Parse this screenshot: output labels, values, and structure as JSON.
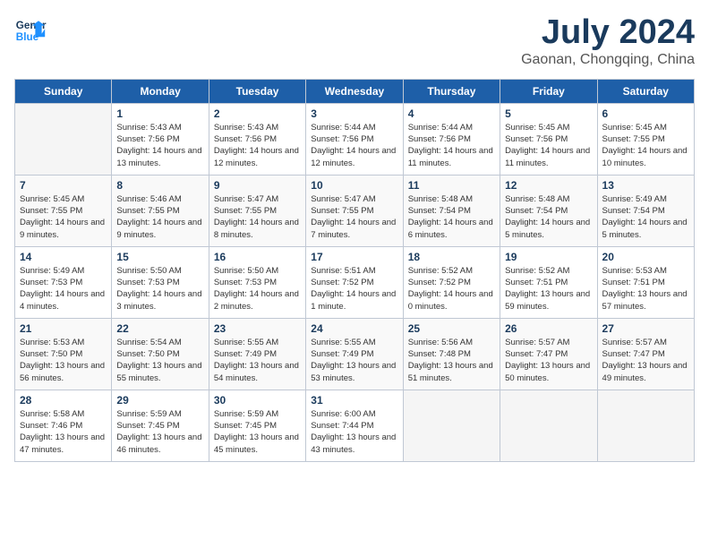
{
  "header": {
    "logo_line1": "General",
    "logo_line2": "Blue",
    "month_title": "July 2024",
    "location": "Gaonan, Chongqing, China"
  },
  "days_of_week": [
    "Sunday",
    "Monday",
    "Tuesday",
    "Wednesday",
    "Thursday",
    "Friday",
    "Saturday"
  ],
  "weeks": [
    [
      {
        "day": "",
        "empty": true
      },
      {
        "day": "1",
        "sunrise": "5:43 AM",
        "sunset": "7:56 PM",
        "daylight": "14 hours and 13 minutes."
      },
      {
        "day": "2",
        "sunrise": "5:43 AM",
        "sunset": "7:56 PM",
        "daylight": "14 hours and 12 minutes."
      },
      {
        "day": "3",
        "sunrise": "5:44 AM",
        "sunset": "7:56 PM",
        "daylight": "14 hours and 12 minutes."
      },
      {
        "day": "4",
        "sunrise": "5:44 AM",
        "sunset": "7:56 PM",
        "daylight": "14 hours and 11 minutes."
      },
      {
        "day": "5",
        "sunrise": "5:45 AM",
        "sunset": "7:56 PM",
        "daylight": "14 hours and 11 minutes."
      },
      {
        "day": "6",
        "sunrise": "5:45 AM",
        "sunset": "7:55 PM",
        "daylight": "14 hours and 10 minutes."
      }
    ],
    [
      {
        "day": "7",
        "sunrise": "5:45 AM",
        "sunset": "7:55 PM",
        "daylight": "14 hours and 9 minutes."
      },
      {
        "day": "8",
        "sunrise": "5:46 AM",
        "sunset": "7:55 PM",
        "daylight": "14 hours and 9 minutes."
      },
      {
        "day": "9",
        "sunrise": "5:47 AM",
        "sunset": "7:55 PM",
        "daylight": "14 hours and 8 minutes."
      },
      {
        "day": "10",
        "sunrise": "5:47 AM",
        "sunset": "7:55 PM",
        "daylight": "14 hours and 7 minutes."
      },
      {
        "day": "11",
        "sunrise": "5:48 AM",
        "sunset": "7:54 PM",
        "daylight": "14 hours and 6 minutes."
      },
      {
        "day": "12",
        "sunrise": "5:48 AM",
        "sunset": "7:54 PM",
        "daylight": "14 hours and 5 minutes."
      },
      {
        "day": "13",
        "sunrise": "5:49 AM",
        "sunset": "7:54 PM",
        "daylight": "14 hours and 5 minutes."
      }
    ],
    [
      {
        "day": "14",
        "sunrise": "5:49 AM",
        "sunset": "7:53 PM",
        "daylight": "14 hours and 4 minutes."
      },
      {
        "day": "15",
        "sunrise": "5:50 AM",
        "sunset": "7:53 PM",
        "daylight": "14 hours and 3 minutes."
      },
      {
        "day": "16",
        "sunrise": "5:50 AM",
        "sunset": "7:53 PM",
        "daylight": "14 hours and 2 minutes."
      },
      {
        "day": "17",
        "sunrise": "5:51 AM",
        "sunset": "7:52 PM",
        "daylight": "14 hours and 1 minute."
      },
      {
        "day": "18",
        "sunrise": "5:52 AM",
        "sunset": "7:52 PM",
        "daylight": "14 hours and 0 minutes."
      },
      {
        "day": "19",
        "sunrise": "5:52 AM",
        "sunset": "7:51 PM",
        "daylight": "13 hours and 59 minutes."
      },
      {
        "day": "20",
        "sunrise": "5:53 AM",
        "sunset": "7:51 PM",
        "daylight": "13 hours and 57 minutes."
      }
    ],
    [
      {
        "day": "21",
        "sunrise": "5:53 AM",
        "sunset": "7:50 PM",
        "daylight": "13 hours and 56 minutes."
      },
      {
        "day": "22",
        "sunrise": "5:54 AM",
        "sunset": "7:50 PM",
        "daylight": "13 hours and 55 minutes."
      },
      {
        "day": "23",
        "sunrise": "5:55 AM",
        "sunset": "7:49 PM",
        "daylight": "13 hours and 54 minutes."
      },
      {
        "day": "24",
        "sunrise": "5:55 AM",
        "sunset": "7:49 PM",
        "daylight": "13 hours and 53 minutes."
      },
      {
        "day": "25",
        "sunrise": "5:56 AM",
        "sunset": "7:48 PM",
        "daylight": "13 hours and 51 minutes."
      },
      {
        "day": "26",
        "sunrise": "5:57 AM",
        "sunset": "7:47 PM",
        "daylight": "13 hours and 50 minutes."
      },
      {
        "day": "27",
        "sunrise": "5:57 AM",
        "sunset": "7:47 PM",
        "daylight": "13 hours and 49 minutes."
      }
    ],
    [
      {
        "day": "28",
        "sunrise": "5:58 AM",
        "sunset": "7:46 PM",
        "daylight": "13 hours and 47 minutes."
      },
      {
        "day": "29",
        "sunrise": "5:59 AM",
        "sunset": "7:45 PM",
        "daylight": "13 hours and 46 minutes."
      },
      {
        "day": "30",
        "sunrise": "5:59 AM",
        "sunset": "7:45 PM",
        "daylight": "13 hours and 45 minutes."
      },
      {
        "day": "31",
        "sunrise": "6:00 AM",
        "sunset": "7:44 PM",
        "daylight": "13 hours and 43 minutes."
      },
      {
        "day": "",
        "empty": true
      },
      {
        "day": "",
        "empty": true
      },
      {
        "day": "",
        "empty": true
      }
    ]
  ]
}
